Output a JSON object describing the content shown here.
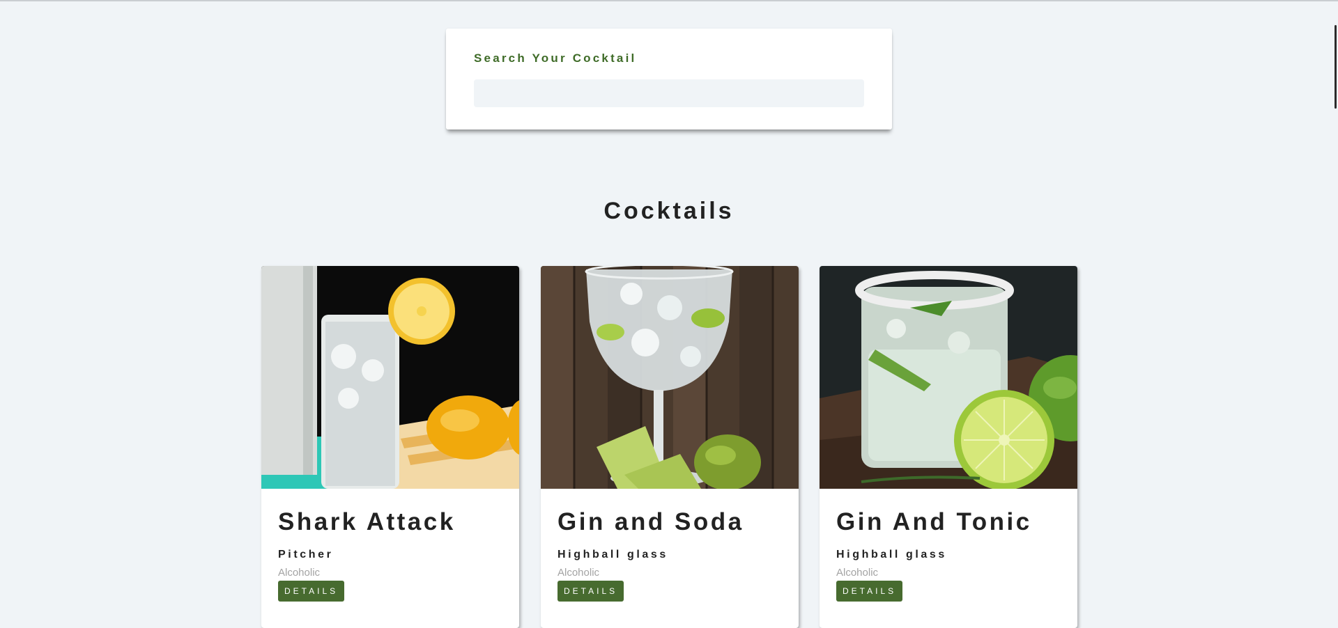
{
  "search": {
    "label": "Search Your Cocktail",
    "value": ""
  },
  "section_title": "Cocktails",
  "cocktails": [
    {
      "name": "Shark Attack",
      "glass": "Pitcher",
      "type": "Alcoholic",
      "button": "DETAILS"
    },
    {
      "name": "Gin and Soda",
      "glass": "Highball glass",
      "type": "Alcoholic",
      "button": "DETAILS"
    },
    {
      "name": "Gin And Tonic",
      "glass": "Highball glass",
      "type": "Alcoholic",
      "button": "DETAILS"
    }
  ],
  "colors": {
    "accent": "#476b2f",
    "label_green": "#3e6b27",
    "background": "#f0f4f7"
  }
}
